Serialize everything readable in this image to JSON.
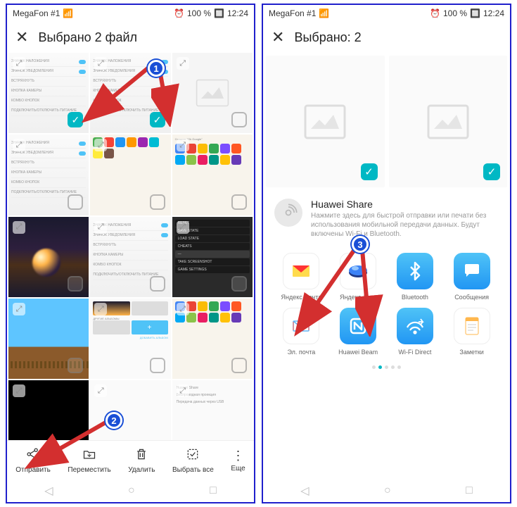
{
  "status": {
    "carrier": "MegaFon #1",
    "battery": "100 %",
    "time": "12:24"
  },
  "left": {
    "title": "Выбрано 2 файл",
    "actions": {
      "send": "Отправить",
      "move": "Переместить",
      "delete": "Удалить",
      "select_all": "Выбрать все",
      "more": "Еще"
    },
    "thumbs": [
      {
        "type": "settings",
        "checked": true
      },
      {
        "type": "settings",
        "checked": true
      },
      {
        "type": "placeholder",
        "checked": false
      },
      {
        "type": "settings",
        "checked": false
      },
      {
        "type": "home",
        "checked": false
      },
      {
        "type": "home2",
        "checked": false
      },
      {
        "type": "space",
        "checked": false
      },
      {
        "type": "settings",
        "checked": false
      },
      {
        "type": "darkmenu",
        "checked": false
      },
      {
        "type": "game",
        "checked": false
      },
      {
        "type": "albums",
        "checked": false
      },
      {
        "type": "home2",
        "checked": false
      },
      {
        "type": "black",
        "checked": false
      },
      {
        "type": "dock",
        "checked": false
      },
      {
        "type": "proj",
        "checked": false
      }
    ],
    "dark_menu_items": [
      "RESET",
      "SAVE STATE",
      "LOAD STATE",
      "CHEATS",
      "—",
      "TAKE SCREENSHOT",
      "GAME SETTINGS"
    ],
    "settings_items": [
      "ЗНАЧОК НАЛОЖЕНИЯ",
      "ЗНАЧОК УВЕДОМЛЕНИЯ",
      "ВСТРЯХНУТЬ",
      "КНОПКА КАМЕРЫ",
      "КОМБО КНОПОК",
      "ПОДКЛЮЧИТЬ/ОТКЛЮЧИТЬ ПИТАНИЕ"
    ],
    "albums_labels": [
      "ДРУГИЕ АЛЬБОМЫ",
      "ДОБАВИТЬ АЛЬБОМ"
    ],
    "proj_labels": [
      "Huawei Share",
      "Беспроводная проекция",
      "Передача данных через USB"
    ]
  },
  "right": {
    "title": "Выбрано: 2",
    "huawei_share": {
      "title": "Huawei Share",
      "desc": "Нажмите здесь для быстрой отправки или печати без использования мобильной передачи данных. Будут включены Wi-Fi и Bluetooth."
    },
    "share_items": [
      {
        "label": "Яндекс.Почта",
        "color": "#fff",
        "icon": "mail-yandex"
      },
      {
        "label": "Яндекс.Диск",
        "color": "#fff",
        "icon": "disk-yandex"
      },
      {
        "label": "Bluetooth",
        "color": "#2196f3",
        "icon": "bluetooth"
      },
      {
        "label": "Сообщения",
        "color": "#2196f3",
        "icon": "message"
      },
      {
        "label": "Эл. почта",
        "color": "#fff",
        "icon": "email"
      },
      {
        "label": "Huawei Beam",
        "color": "#2196f3",
        "icon": "nfc"
      },
      {
        "label": "Wi-Fi Direct",
        "color": "#2196f3",
        "icon": "wifi"
      },
      {
        "label": "Заметки",
        "color": "#fff",
        "icon": "notes"
      }
    ]
  },
  "annotations": {
    "b1": "1",
    "b2": "2",
    "b3": "3"
  }
}
